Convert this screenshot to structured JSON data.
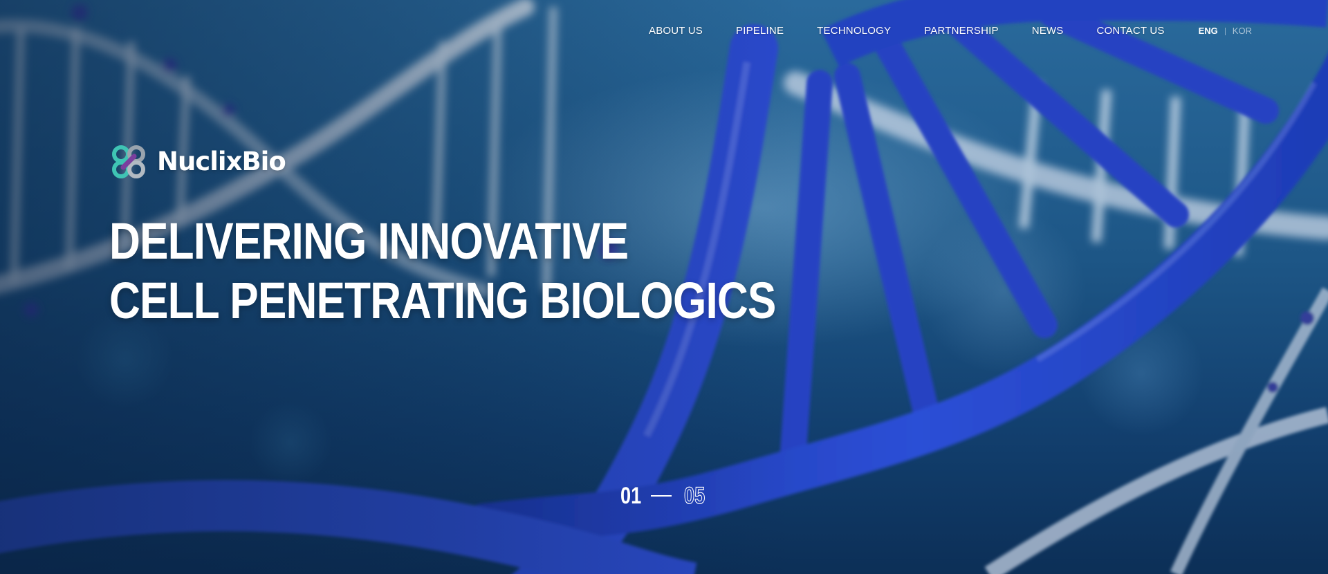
{
  "nav": {
    "items": [
      {
        "label": "ABOUT US"
      },
      {
        "label": "PIPELINE"
      },
      {
        "label": "TECHNOLOGY"
      },
      {
        "label": "PARTNERSHIP"
      },
      {
        "label": "NEWS"
      },
      {
        "label": "CONTACT US"
      }
    ],
    "lang": {
      "active": "ENG",
      "inactive": "KOR"
    }
  },
  "brand": {
    "name": "NuclixBio",
    "logo_icon": "nuclixbio-logo-icon"
  },
  "hero": {
    "headline": [
      "DELIVERING INNOVATIVE",
      "CELL PENETRATING BIOLOGICS"
    ],
    "background": "dna-double-helix-image"
  },
  "slider": {
    "current": "01",
    "total": "05"
  },
  "colors": {
    "background_blue": "#1d5686",
    "helix_blue": "#2a46c4",
    "logo_teal": "#3fc4b4",
    "logo_purple": "#7a3f9e",
    "text": "#ffffff"
  }
}
